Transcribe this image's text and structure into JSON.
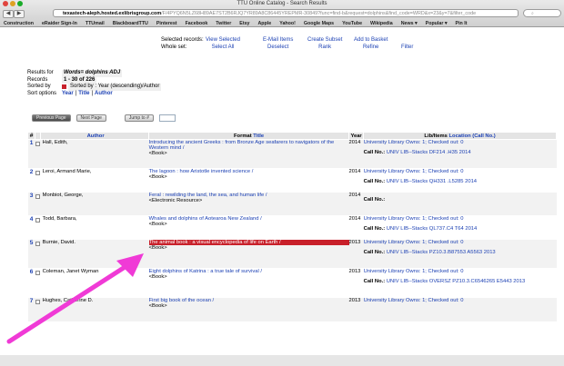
{
  "browser": {
    "window_title": "TTU Online Catalog - Search Results",
    "url_host": "texastech-aleph.hosted.exlibrisgroup.com",
    "url_rest": "/F/4PYQ6N5LZ68H89AE7ST2B6RJQ7YR89A8C86445YREPMR-30849?func=find-b&request=dolphins&find_code=WRD&x=23&y=7&filter_code",
    "nav_back": "◀",
    "nav_forward": "▶",
    "bookmarks": [
      "Construction",
      "eRaider Sign-In",
      "TTUmail",
      "BlackboardTTU",
      "Pinterest",
      "Facebook",
      "Twitter",
      "Etsy",
      "Apple",
      "Yahoo!",
      "Google Maps",
      "YouTube",
      "Wikipedia",
      "News ▾",
      "Popular ▾",
      "Pin It"
    ]
  },
  "selection": {
    "label_selected": "Selected records:",
    "label_whole": "Whole set:",
    "actions": [
      {
        "top": "View Selected",
        "bottom": "Select All"
      },
      {
        "top": "E-Mail Items",
        "bottom": "Deselect"
      },
      {
        "top": "Create Subset",
        "bottom": "Rank"
      },
      {
        "top": "Add to Basket",
        "bottom": "Refine"
      },
      {
        "top": "",
        "bottom": "Filter"
      }
    ]
  },
  "results_info": {
    "results_for_label": "Results for",
    "results_for_value": "Words= dolphins ADJ",
    "records_label": "Records",
    "records_value": "1 - 30 of 226",
    "sorted_label": "Sorted by",
    "sorted_value": "Sorted by : Year (descending)/Author",
    "sort_options_label": "Sort options",
    "sort_year": "Year",
    "sort_title": "Title",
    "sort_author": "Author",
    "sep": "|"
  },
  "pager": {
    "previous": "Previous Page",
    "next": "Next Page",
    "jump": "Jump to #"
  },
  "table": {
    "header_num": "#",
    "header_author": "Author",
    "header_format": "Format",
    "header_title": "Title",
    "header_year": "Year",
    "header_lib": "Lib/Items",
    "header_location": "Location (Call No.)",
    "callno_label": "Call No.:",
    "rows": [
      {
        "num": "1",
        "author": "Hall, Edith,",
        "title": "Introducing the ancient Greeks : from Bronze Age seafarers to navigators of the Western mind /",
        "format": "<Book>",
        "year": "2014",
        "items": "University Library Owns: 1; Checked out: 0",
        "callno": "UNIV LIB--Stacks DF214 .H35 2014"
      },
      {
        "num": "2",
        "author": "Leroi, Armand Marie,",
        "title": "The lagoon : how Aristotle invented science /",
        "format": "<Book>",
        "year": "2014",
        "items": "University Library Owns: 1; Checked out: 0",
        "callno": "UNIV LIB--Stacks QH331 .L5285 2014"
      },
      {
        "num": "3",
        "author": "Monbiot, George,",
        "title": "Feral : rewilding the land, the sea, and human life /",
        "format": "<Electronic Resource>",
        "year": "2014",
        "items": "",
        "callno": ""
      },
      {
        "num": "4",
        "author": "Todd, Barbara,",
        "title": "Whales and dolphins of Aotearoa New Zealand /",
        "format": "<Book>",
        "year": "2014",
        "items": "University Library Owns: 1; Checked out: 0",
        "callno": "UNIV LIB--Stacks QL737.C4 T64 2014"
      },
      {
        "num": "5",
        "author": "Burnie, David.",
        "title": "The animal book : a visual encyclopedia of life on Earth /",
        "format": "<Book>",
        "year": "2013",
        "items": "University Library Owns: 1; Checked out: 0",
        "callno": "UNIV LIB--Stacks PZ10.3.B87553 A5563 2013"
      },
      {
        "num": "6",
        "author": "Coleman, Janet Wyman",
        "title": "Eight dolphins of Katrina : a true tale of survival /",
        "format": "<Book>",
        "year": "2013",
        "items": "University Library Owns: 1; Checked out: 0",
        "callno": "UNIV LIB--Stacks OVERSZ PZ10.3.C6546265 E5443 2013"
      },
      {
        "num": "7",
        "author": "Hughes, Catherine D.",
        "title": "First big book of the ocean /",
        "format": "<Book>",
        "year": "2013",
        "items": "University Library Owns: 1; Checked out: 0",
        "callno": ""
      }
    ]
  },
  "annotation": {
    "arrow_color": "#f03ad6"
  }
}
